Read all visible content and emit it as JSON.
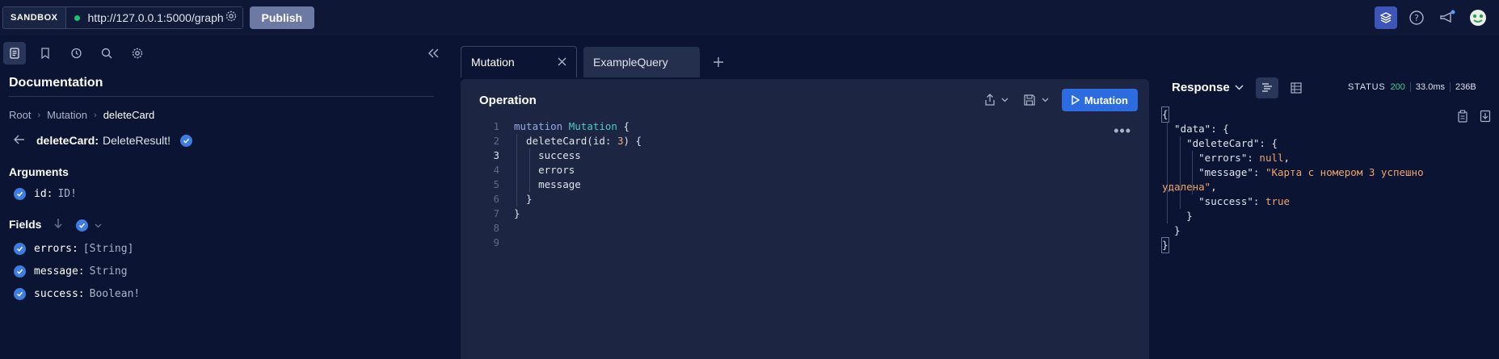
{
  "topbar": {
    "sandbox_label": "SANDBOX",
    "url": "http://127.0.0.1:5000/graph",
    "publish_label": "Publish"
  },
  "docs": {
    "title": "Documentation",
    "breadcrumb": [
      "Root",
      "Mutation",
      "deleteCard"
    ],
    "field_name": "deleteCard:",
    "field_type": "DeleteResult!",
    "arguments_label": "Arguments",
    "arguments": [
      {
        "name": "id:",
        "type": "ID!"
      }
    ],
    "fields_label": "Fields",
    "fields": [
      {
        "name": "errors:",
        "type": "[String]"
      },
      {
        "name": "message:",
        "type": "String"
      },
      {
        "name": "success:",
        "type": "Boolean!"
      }
    ]
  },
  "tabs": [
    {
      "label": "Mutation",
      "active": true
    },
    {
      "label": "ExampleQuery",
      "active": false
    }
  ],
  "operation": {
    "title": "Operation",
    "run_label": "Mutation",
    "line_numbers": [
      "1",
      "2",
      "3",
      "4",
      "5",
      "6",
      "7",
      "8",
      "9"
    ],
    "code": {
      "l1_kw": "mutation",
      "l1_name": "Mutation",
      "l1_rest": " {",
      "l2_a": "  deleteCard(id: ",
      "l2_num": "3",
      "l2_b": ") {",
      "l3": "    success",
      "l4": "    errors",
      "l5": "    message",
      "l6": "  }",
      "l7": "}"
    }
  },
  "response": {
    "title": "Response",
    "status_label": "STATUS",
    "status_code": "200",
    "time": "33.0ms",
    "size": "236B",
    "json": {
      "j1": "{",
      "j2": "  \"data\": {",
      "j3": "    \"deleteCard\": {",
      "j4_key": "      \"errors\": ",
      "j4_val": "null",
      "j4_end": ",",
      "j5_key": "      \"message\": ",
      "j5_val": "\"Карта с номером 3 успешно",
      "j6_val": "удалена\"",
      "j6_end": ",",
      "j7_key": "      \"success\": ",
      "j7_val": "true",
      "j8": "    }",
      "j9": "  }",
      "j10": "}"
    }
  },
  "colors": {
    "accent": "#2c6be0",
    "background": "#0b1533",
    "panel": "#1c2541",
    "status_ok": "#3fcf8e"
  }
}
